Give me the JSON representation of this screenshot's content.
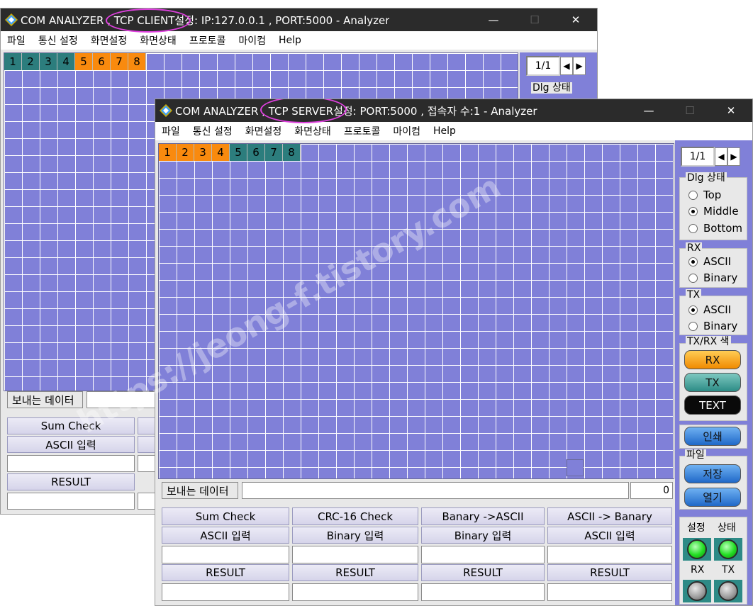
{
  "client": {
    "title": "COM ANALYZER , TCP CLIENT설정: IP:127.0.0.1 , PORT:5000  - Analyzer",
    "menu": [
      "파일",
      "통신 설정",
      "화면설정",
      "화면상태",
      "프로토콜",
      "마이컴",
      "Help"
    ],
    "tabs": [
      "1",
      "2",
      "3",
      "4",
      "5",
      "6",
      "7",
      "8"
    ],
    "page": "1/1",
    "dlg_group": "Dlg 상태",
    "send_label": "보내는 데이터",
    "sum_check": "Sum Check",
    "ascii_input": "ASCII 입력",
    "result": "RESULT"
  },
  "server": {
    "title": "COM ANALYZER , TCP SERVER설정: PORT:5000 , 접속자 수:1 - Analyzer",
    "menu": [
      "파일",
      "통신 설정",
      "화면설정",
      "화면상태",
      "프로토콜",
      "마이컴",
      "Help"
    ],
    "tabs": [
      "1",
      "2",
      "3",
      "4",
      "5",
      "6",
      "7",
      "8"
    ],
    "page": "1/1",
    "dlg_group": "Dlg 상태",
    "dlg_options": [
      "Top",
      "Middle",
      "Bottom"
    ],
    "dlg_selected": "Middle",
    "rx_group": "RX",
    "rx_options": [
      "ASCII",
      "Binary"
    ],
    "rx_selected": "ASCII",
    "tx_group": "TX",
    "tx_options": [
      "ASCII",
      "Binary"
    ],
    "tx_selected": "ASCII",
    "color_group": "TX/RX 색",
    "color_buttons": [
      "RX",
      "TX",
      "TEXT"
    ],
    "print_button": "인쇄",
    "file_group": "파일",
    "save_button": "저장",
    "open_button": "열기",
    "status_labels": [
      "설정",
      "상태",
      "RX",
      "TX"
    ],
    "send_label": "보내는 데이터",
    "send_count": "0",
    "columns": [
      {
        "header": "Sum Check",
        "input_label": "ASCII 입력",
        "result": "RESULT"
      },
      {
        "header": "CRC-16 Check",
        "input_label": "Binary 입력",
        "result": "RESULT"
      },
      {
        "header": "Banary ->ASCII",
        "input_label": "Binary 입력",
        "result": "RESULT"
      },
      {
        "header": "ASCII -> Banary",
        "input_label": "ASCII 입력",
        "result": "RESULT"
      }
    ]
  },
  "watermark": "https://jeong-f.tistory.com",
  "colors": {
    "grid": "#8080d8",
    "tab_teal": "#2c7d7d",
    "tab_orange": "#f98a0e",
    "titlebar": "#2b2b2b",
    "annotation": "#e040e0",
    "led_on": "#22dd22"
  }
}
